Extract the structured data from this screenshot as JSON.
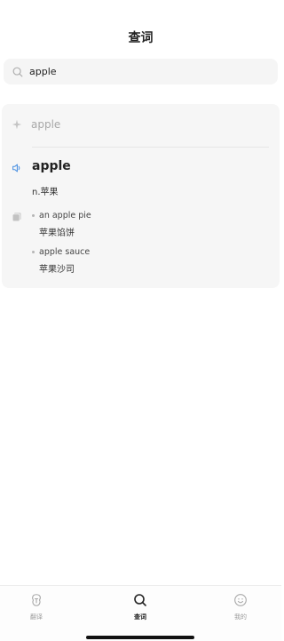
{
  "header": {
    "title": "查词"
  },
  "search": {
    "value": "apple",
    "icon": "search-icon"
  },
  "results": {
    "suggestion": {
      "word": "apple",
      "icon": "sparkle-icon"
    },
    "entry": {
      "word": "apple",
      "definition": "n.苹果",
      "phrases": [
        {
          "en": "an apple pie",
          "zh": "苹果馅饼"
        },
        {
          "en": "apple sauce",
          "zh": "苹果沙司"
        }
      ]
    }
  },
  "tabbar": {
    "tabs": [
      {
        "label": "翻译",
        "icon": "translate-icon"
      },
      {
        "label": "查词",
        "icon": "search-icon",
        "active": true
      },
      {
        "label": "我的",
        "icon": "smiley-icon"
      }
    ]
  },
  "colors": {
    "accent": "#4a90e2",
    "card_bg": "#f6f6f6"
  }
}
